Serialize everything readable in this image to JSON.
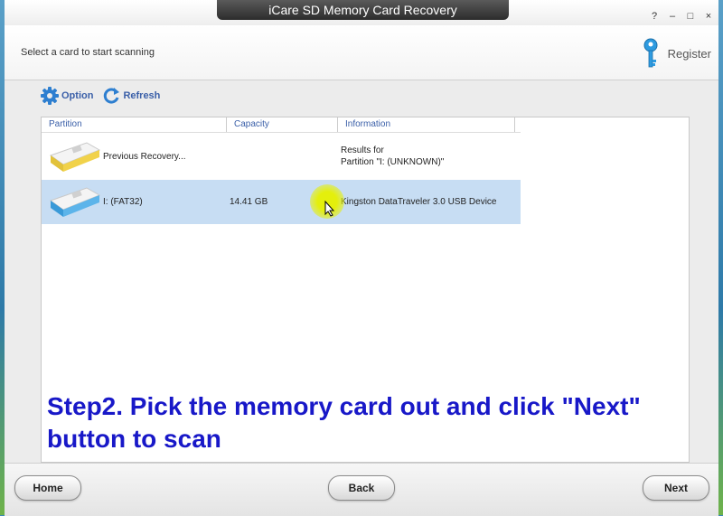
{
  "window": {
    "title": "iCare SD Memory Card Recovery"
  },
  "window_controls": {
    "help": "?",
    "minimize": "–",
    "maximize": "□",
    "close": "×"
  },
  "header": {
    "instruction": "Select a card to start scanning",
    "register_label": "Register"
  },
  "toolbar": {
    "option_label": "Option",
    "refresh_label": "Refresh"
  },
  "table": {
    "columns": [
      "Partition",
      "Capacity",
      "Information"
    ],
    "rows": [
      {
        "partition": "Previous Recovery...",
        "capacity": "",
        "info_line1": "Results for",
        "info_line2": "Partition \"I:  (UNKNOWN)\"",
        "selected": false
      },
      {
        "partition": "I:   (FAT32)",
        "capacity": "14.41 GB",
        "info_line1": "Kingston  DataTraveler 3.0  USB Device",
        "info_line2": "",
        "selected": true
      }
    ]
  },
  "caption": {
    "line1": "Step2. Pick the memory card out and click \"Next\"",
    "line2": "button to scan"
  },
  "footer": {
    "home_label": "Home",
    "back_label": "Back",
    "next_label": "Next"
  },
  "colors": {
    "accent_blue": "#3a5fa8",
    "caption_blue": "#1818c8",
    "selection": "#c7ddf3",
    "highlight": "#e6f000"
  }
}
